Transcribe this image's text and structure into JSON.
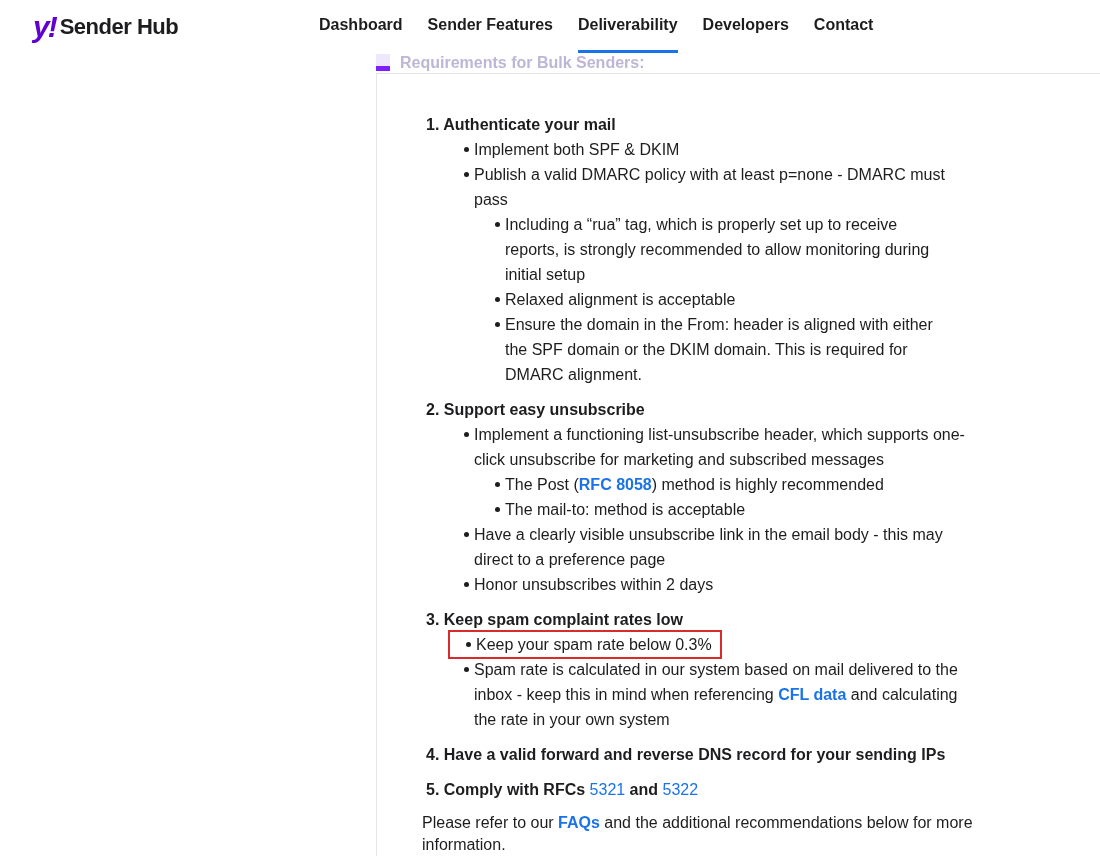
{
  "header": {
    "logo_mark": "y!",
    "logo_text": "Sender Hub",
    "nav": [
      {
        "label": "Dashboard",
        "selected": false
      },
      {
        "label": "Sender Features",
        "selected": false
      },
      {
        "label": "Deliverability",
        "selected": true
      },
      {
        "label": "Developers",
        "selected": false
      },
      {
        "label": "Contact",
        "selected": false
      }
    ]
  },
  "faded_heading": "Requirements for Bulk Senders:",
  "sections": [
    {
      "title": [
        {
          "text": "1. Authenticate your mail"
        }
      ],
      "items": [
        {
          "highlighted": false,
          "parts": [
            {
              "text": "Implement both SPF & DKIM"
            }
          ]
        },
        {
          "highlighted": false,
          "parts": [
            {
              "text": "Publish a valid DMARC policy with at least p=none - DMARC must pass"
            }
          ],
          "children": [
            {
              "highlighted": false,
              "parts": [
                {
                  "text": "Including a “rua” tag, which is properly set up to receive reports, is strongly recommended to allow monitoring during initial setup"
                }
              ]
            },
            {
              "highlighted": false,
              "parts": [
                {
                  "text": "Relaxed alignment is acceptable"
                }
              ]
            },
            {
              "highlighted": false,
              "parts": [
                {
                  "text": "Ensure the domain in the From: header is aligned with either the SPF domain or the DKIM domain. This is required for DMARC alignment."
                }
              ]
            }
          ]
        }
      ]
    },
    {
      "title": [
        {
          "text": "2. Support easy unsubscribe"
        }
      ],
      "items": [
        {
          "highlighted": false,
          "parts": [
            {
              "text": "Implement a functioning list-unsubscribe header, which supports one-click unsubscribe for marketing and subscribed messages"
            }
          ],
          "children": [
            {
              "highlighted": false,
              "parts": [
                {
                  "text": "The Post ("
                },
                {
                  "text": "RFC 8058",
                  "kind": "link"
                },
                {
                  "text": ") method is highly recommended"
                }
              ]
            },
            {
              "highlighted": false,
              "parts": [
                {
                  "text": "The mail-to: method is acceptable"
                }
              ]
            }
          ]
        },
        {
          "highlighted": false,
          "parts": [
            {
              "text": "Have a clearly visible unsubscribe link in the email body - this may direct to a preference page"
            }
          ]
        },
        {
          "highlighted": false,
          "parts": [
            {
              "text": "Honor unsubscribes within 2 days"
            }
          ]
        }
      ]
    },
    {
      "title": [
        {
          "text": "3. Keep spam complaint rates low"
        }
      ],
      "items": [
        {
          "highlighted": true,
          "parts": [
            {
              "text": "Keep your spam rate below 0.3%"
            }
          ]
        },
        {
          "highlighted": false,
          "parts": [
            {
              "text": "Spam rate is calculated in our system based on mail delivered to the inbox - keep this in mind when referencing "
            },
            {
              "text": "CFL data",
              "kind": "link"
            },
            {
              "text": " and calculating the rate in your own system"
            }
          ]
        }
      ]
    },
    {
      "title": [
        {
          "text": "4. Have a valid forward and reverse DNS record for your sending IPs"
        }
      ]
    },
    {
      "title": [
        {
          "text": "5. Comply with RFCs "
        },
        {
          "text": "5321",
          "kind": "link"
        },
        {
          "text": " and "
        },
        {
          "text": "5322",
          "kind": "link"
        }
      ]
    }
  ],
  "footer_note": [
    {
      "text": "Please refer to our "
    },
    {
      "text": "FAQs",
      "kind": "link"
    },
    {
      "text": " and the additional recommendations below for more information."
    }
  ]
}
